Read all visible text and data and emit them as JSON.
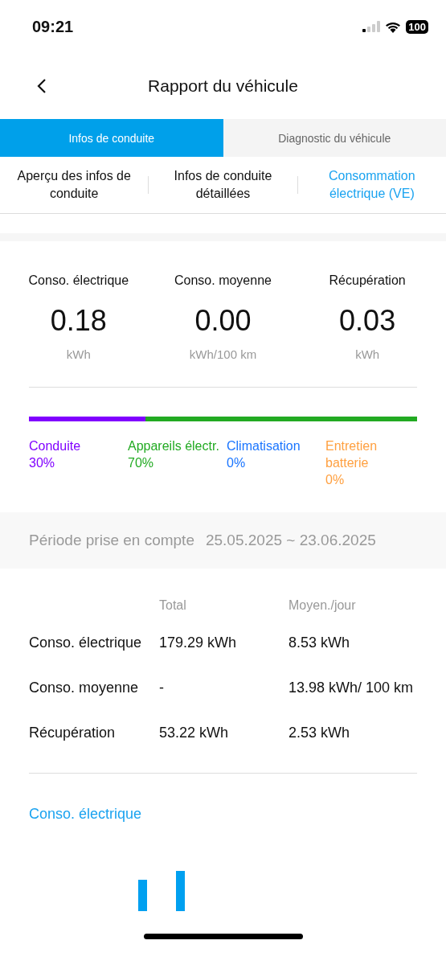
{
  "status_bar": {
    "time": "09:21",
    "battery": "100"
  },
  "header": {
    "title": "Rapport du véhicule"
  },
  "tabs": [
    {
      "label": "Infos de conduite",
      "selected": true
    },
    {
      "label": "Diagnostic du véhicule",
      "selected": false
    }
  ],
  "sub_tabs": [
    {
      "label": "Aperçu des infos de conduite",
      "selected": false
    },
    {
      "label": "Infos de conduite détaillées",
      "selected": false
    },
    {
      "label": "Consommation électrique (VE)",
      "selected": true
    }
  ],
  "stats": [
    {
      "label": "Conso. électrique",
      "value": "0.18",
      "unit": "kWh"
    },
    {
      "label": "Conso. moyenne",
      "value": "0.00",
      "unit": "kWh/100 km"
    },
    {
      "label": "Récupération",
      "value": "0.03",
      "unit": "kWh"
    }
  ],
  "breakdown": [
    {
      "label": "Conduite",
      "percent": "30%",
      "color": "#8000ff"
    },
    {
      "label": "Appareils électr.",
      "percent": "70%",
      "color": "#22aa22"
    },
    {
      "label": "Climatisation",
      "percent": "0%",
      "color": "#1a75ff"
    },
    {
      "label": "Entretien batterie",
      "percent": "0%",
      "color": "#ffa040"
    }
  ],
  "period": {
    "label": "Période prise en compte",
    "range": "25.05.2025 ~ 23.06.2025"
  },
  "table": {
    "columns": [
      "Total",
      "Moyen./jour"
    ],
    "rows": [
      {
        "label": "Conso. électrique",
        "total": "179.29 kWh",
        "daily": "8.53 kWh"
      },
      {
        "label": "Conso. moyenne",
        "total": "-",
        "daily": "13.98 kWh/ 100 km"
      },
      {
        "label": "Récupération",
        "total": "53.22 kWh",
        "daily": "2.53 kWh"
      }
    ]
  },
  "section_title": "Conso. électrique"
}
